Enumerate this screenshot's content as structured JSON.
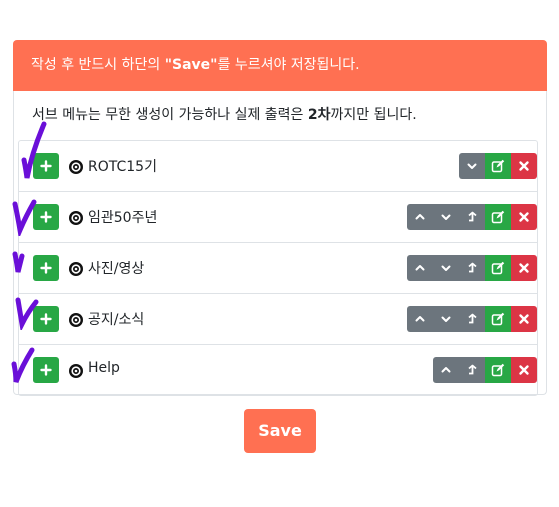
{
  "notice": {
    "prefix": "작성 후 반드시 하단의 ",
    "highlight": "\"Save\"",
    "suffix": "를 누르셔야 저장됩니다."
  },
  "info": {
    "prefix": "서브 메뉴는 무한 생성이 가능하나 실제 출력은 ",
    "highlight": "2차",
    "suffix": "까지만 됩니다."
  },
  "menu_items": [
    {
      "label": "ROTC15기",
      "buttons": [
        "chevron-down",
        "edit",
        "delete"
      ]
    },
    {
      "label": "임관50주년",
      "buttons": [
        "chevron-up",
        "chevron-down",
        "outdent",
        "edit",
        "delete"
      ]
    },
    {
      "label": "사진/영상",
      "buttons": [
        "chevron-up",
        "chevron-down",
        "outdent",
        "edit",
        "delete"
      ]
    },
    {
      "label": "공지/소식",
      "buttons": [
        "chevron-up",
        "chevron-down",
        "outdent",
        "edit",
        "delete"
      ]
    },
    {
      "label": "Help",
      "buttons": [
        "chevron-up",
        "outdent",
        "edit",
        "delete"
      ]
    }
  ],
  "save_label": "Save",
  "colors": {
    "accent": "#ff7052",
    "success": "#28a745",
    "danger": "#dc3545",
    "secondary": "#6c757d",
    "annotation": "#6a0fd8"
  }
}
